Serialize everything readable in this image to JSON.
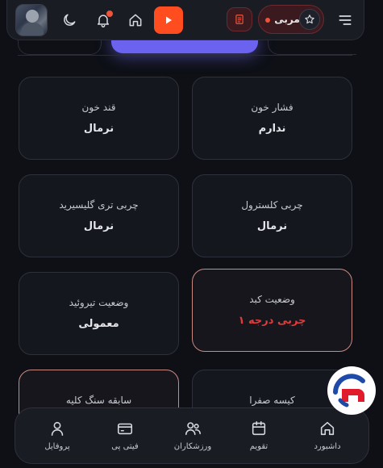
{
  "header": {
    "role_label": "مربی",
    "notification_count": "0"
  },
  "cards": [
    {
      "label": "فشار خون",
      "value": "ندارم"
    },
    {
      "label": "قند خون",
      "value": "نرمال"
    },
    {
      "label": "چربی کلسترول",
      "value": "نرمال"
    },
    {
      "label": "چربی تری گلیسیرید",
      "value": "نرمال"
    },
    {
      "label": "وضعیت کبد",
      "value": "چربی درجه ۱",
      "alert": true
    },
    {
      "label": "وضعیت تیروئید",
      "value": "معمولی"
    },
    {
      "label": "کیسه صفرا",
      "value": ""
    },
    {
      "label": "سابقه سنگ کلیه",
      "value": "",
      "alert": true
    }
  ],
  "nav": [
    {
      "label": "داشبورد",
      "icon": "home-icon"
    },
    {
      "label": "تقویم",
      "icon": "calendar-icon"
    },
    {
      "label": "ورزشکاران",
      "icon": "users-icon"
    },
    {
      "label": "فیتی پی",
      "icon": "card-icon"
    },
    {
      "label": "پروفایل",
      "icon": "user-icon"
    }
  ],
  "colors": {
    "accent_orange": "#ff4d1f",
    "accent_purple": "#6b63f0",
    "alert_red": "#e23b3b",
    "alert_border": "#c98a84"
  }
}
